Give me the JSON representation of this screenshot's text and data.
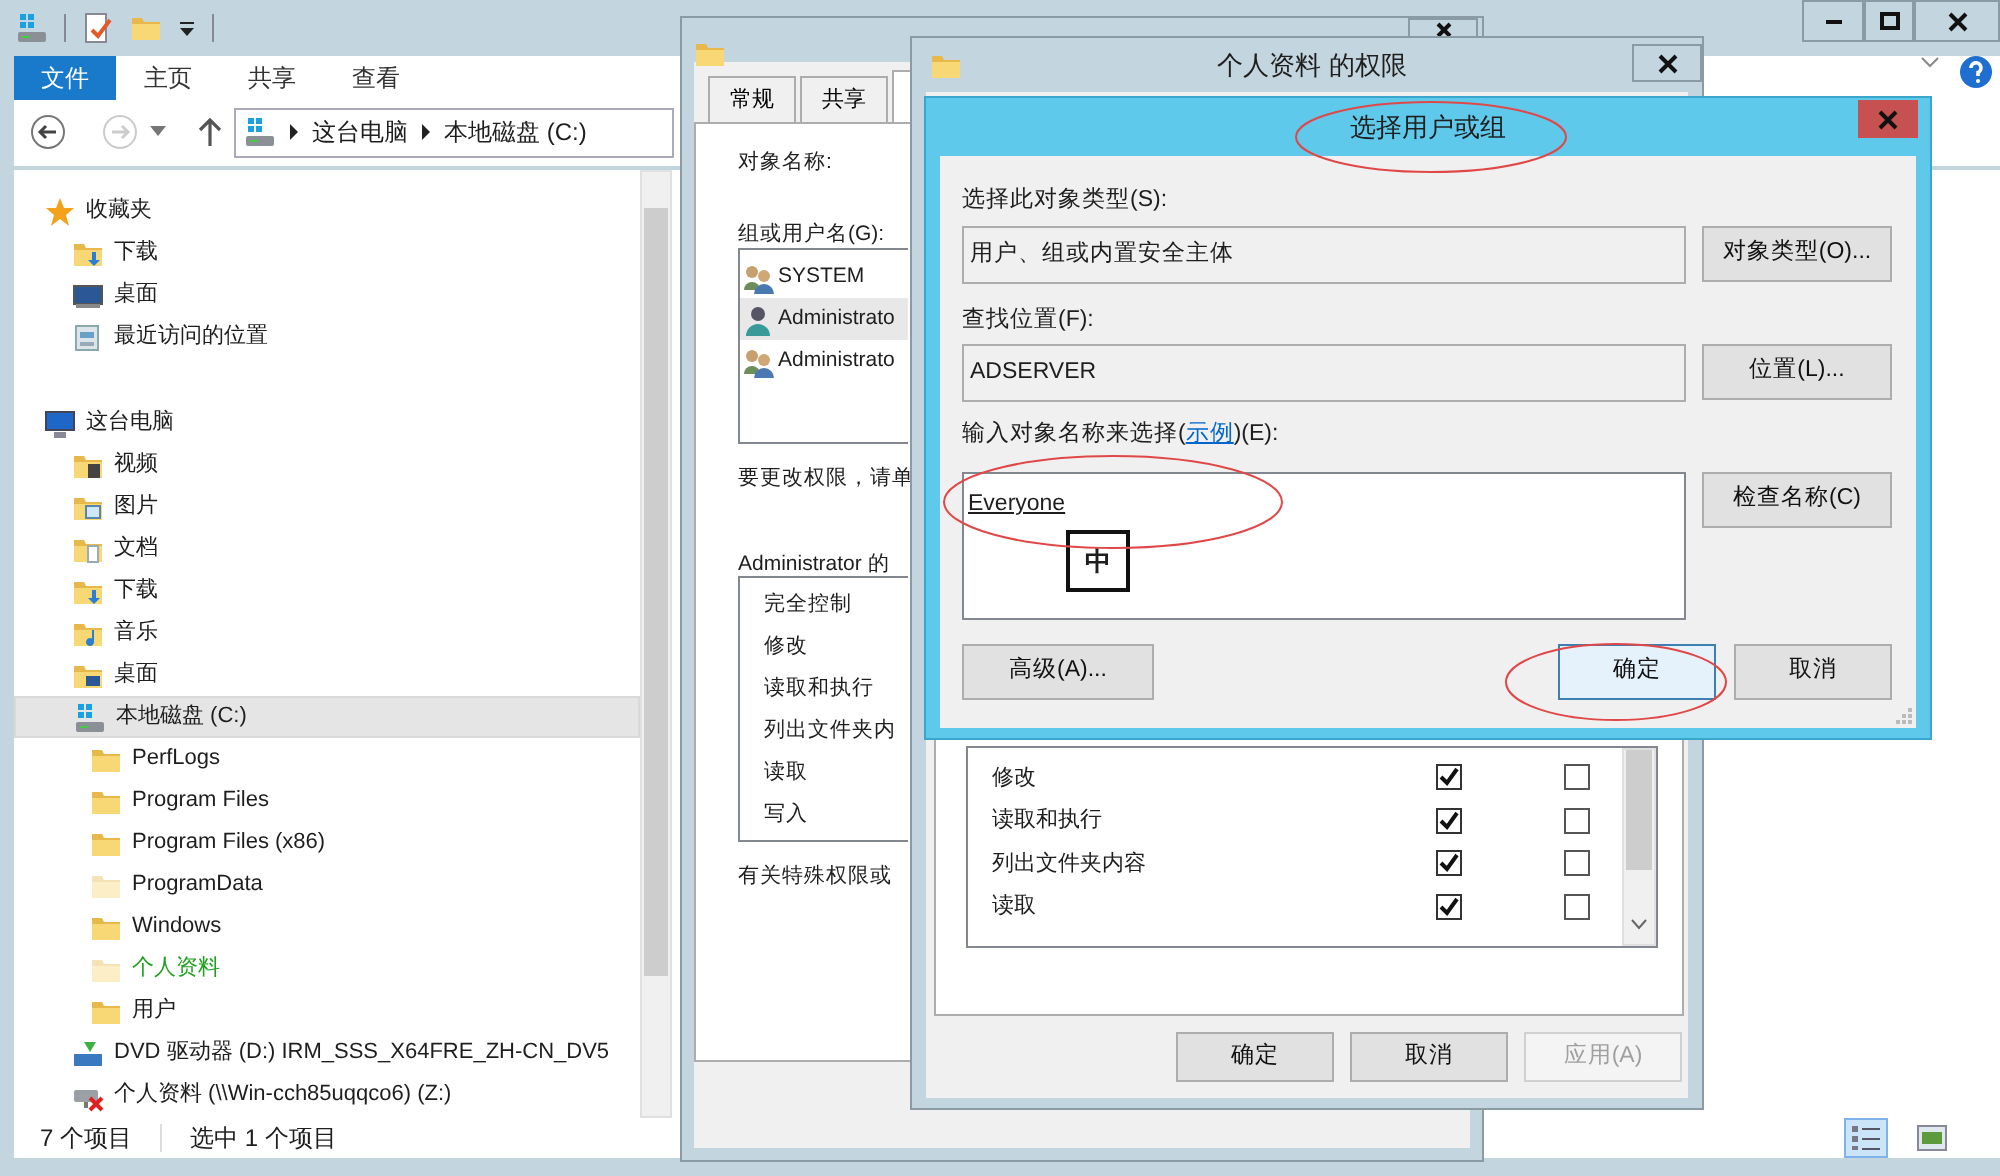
{
  "explorer": {
    "ribbon_tabs": [
      {
        "label": "文件",
        "selected": true
      },
      {
        "label": "主页",
        "selected": false
      },
      {
        "label": "共享",
        "selected": false
      },
      {
        "label": "查看",
        "selected": false
      }
    ],
    "breadcrumb": [
      "这台电脑",
      "本地磁盘 (C:)"
    ],
    "nav_tree": [
      {
        "label": "收藏夹",
        "kind": "star",
        "selected": false,
        "children": [
          {
            "label": "下载",
            "kind": "download",
            "selected": false
          },
          {
            "label": "桌面",
            "kind": "desktop",
            "selected": false
          },
          {
            "label": "最近访问的位置",
            "kind": "recent",
            "selected": false
          }
        ]
      },
      {
        "label": "这台电脑",
        "kind": "computer",
        "selected": false,
        "children": [
          {
            "label": "视频",
            "kind": "video",
            "selected": false
          },
          {
            "label": "图片",
            "kind": "pictures",
            "selected": false
          },
          {
            "label": "文档",
            "kind": "documents",
            "selected": false
          },
          {
            "label": "下载",
            "kind": "download",
            "selected": false
          },
          {
            "label": "音乐",
            "kind": "music",
            "selected": false
          },
          {
            "label": "桌面",
            "kind": "desktopfolder",
            "selected": false
          },
          {
            "label": "本地磁盘 (C:)",
            "kind": "drive",
            "selected": true,
            "children": [
              {
                "label": "PerfLogs",
                "kind": "folder",
                "selected": false,
                "hidden": false,
                "encrypted": false
              },
              {
                "label": "Program Files",
                "kind": "folder",
                "selected": false,
                "hidden": false,
                "encrypted": false
              },
              {
                "label": "Program Files (x86)",
                "kind": "folder",
                "selected": false,
                "hidden": false,
                "encrypted": false
              },
              {
                "label": "ProgramData",
                "kind": "folder",
                "selected": false,
                "hidden": true,
                "encrypted": false
              },
              {
                "label": "Windows",
                "kind": "folder",
                "selected": false,
                "hidden": false,
                "encrypted": false
              },
              {
                "label": "个人资料",
                "kind": "folder",
                "selected": false,
                "hidden": true,
                "encrypted": true
              },
              {
                "label": "用户",
                "kind": "folder",
                "selected": false,
                "hidden": false,
                "encrypted": false
              }
            ]
          },
          {
            "label": "DVD 驱动器 (D:) IRM_SSS_X64FRE_ZH-CN_DV5",
            "kind": "dvd",
            "selected": false
          },
          {
            "label": "个人资料 (\\\\Win-cch85uqqco6) (Z:)",
            "kind": "network",
            "selected": false
          }
        ]
      }
    ],
    "status_bar": {
      "item_count": "7 个项目",
      "selection": "选中 1 个项目"
    }
  },
  "properties_window": {
    "tabs": [
      {
        "label": "常规",
        "selected": false
      },
      {
        "label": "共享",
        "selected": false
      }
    ],
    "object_name_label": "对象名称:",
    "groups_label": "组或用户名(G):",
    "principals": [
      {
        "name": "SYSTEM",
        "kind": "group",
        "selected": false
      },
      {
        "name": "Administrato",
        "kind": "user",
        "selected": true
      },
      {
        "name": "Administrato",
        "kind": "group",
        "selected": false
      }
    ],
    "change_hint": "要更改权限，请单",
    "permissions_label": "Administrator 的",
    "permissions": [
      "完全控制",
      "修改",
      "读取和执行",
      "列出文件夹内",
      "读取",
      "写入"
    ],
    "special_hint": "有关特殊权限或"
  },
  "permissions_window": {
    "title": "个人资料 的权限",
    "permissions": [
      {
        "name": "修改",
        "allow": true,
        "deny": false
      },
      {
        "name": "读取和执行",
        "allow": true,
        "deny": false
      },
      {
        "name": "列出文件夹内容",
        "allow": true,
        "deny": false
      },
      {
        "name": "读取",
        "allow": true,
        "deny": false
      }
    ],
    "buttons": [
      {
        "label": "确定",
        "disabled": false
      },
      {
        "label": "取消",
        "disabled": false
      },
      {
        "label": "应用(A)",
        "disabled": true
      }
    ]
  },
  "select_dialog": {
    "title": "选择用户或组",
    "object_type_label": "选择此对象类型(S):",
    "object_type_value": "用户、组或内置安全主体",
    "object_type_button": "对象类型(O)...",
    "location_label": "查找位置(F):",
    "location_value": "ADSERVER",
    "location_button": "位置(L)...",
    "names_label_before": "输入对象名称来选择(",
    "names_label_link": "示例",
    "names_label_after": ")(E):",
    "names_value": "Everyone",
    "check_names_button": "检查名称(C)",
    "ime_indicator": "中",
    "advanced_button": "高级(A)...",
    "buttons": [
      {
        "label": "确定",
        "focused": true
      },
      {
        "label": "取消",
        "focused": false
      }
    ]
  }
}
